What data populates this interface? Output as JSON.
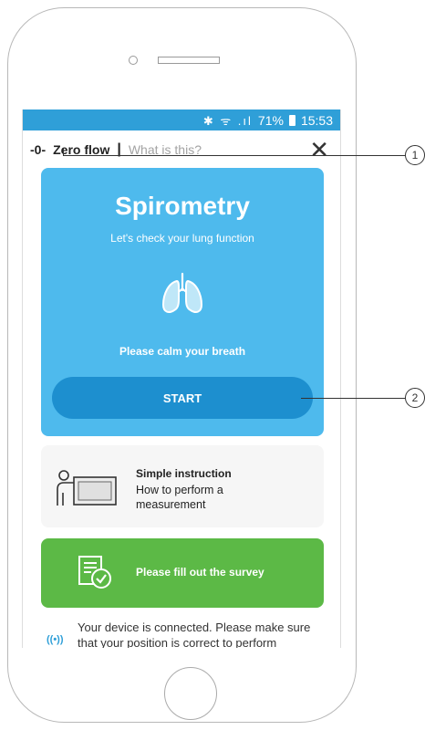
{
  "statusbar": {
    "icons": "✱ ᯤ .ıl",
    "battery": "71%",
    "time": "15:53"
  },
  "topbar": {
    "zero_icon": "-0-",
    "zero_label": "Zero flow",
    "separator": "|",
    "what_is": "What is this?",
    "close": "✕"
  },
  "spirometry": {
    "title": "Spirometry",
    "subtitle": "Let's check your lung function",
    "calm": "Please calm your breath",
    "start": "START"
  },
  "instruction": {
    "title": "Simple instruction",
    "text": "How to perform a measurement"
  },
  "survey": {
    "label": "Please fill out the survey"
  },
  "connection": {
    "icon": "((•))",
    "text": "Your device is connected. Please make sure that your position is correct to perform"
  },
  "callouts": {
    "one": "1",
    "two": "2"
  },
  "colors": {
    "statusbar": "#2f9fd8",
    "spiro_card": "#4ebaed",
    "start_button": "#1d8fcf",
    "survey_card": "#5cb946"
  }
}
